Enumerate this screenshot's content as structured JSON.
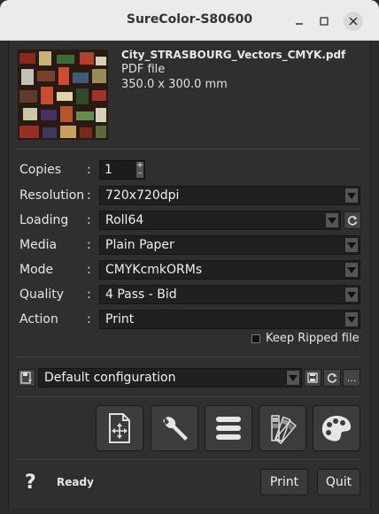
{
  "window": {
    "title": "SureColor-S80600"
  },
  "file": {
    "name": "City_STRASBOURG_Vectors_CMYK.pdf",
    "type": "PDF file",
    "size": "350.0 x 300.0 mm"
  },
  "settings": {
    "copies": {
      "label": "Copies",
      "colon": ":",
      "value": "1"
    },
    "resolution": {
      "label": "Resolution",
      "colon": ":",
      "value": "720x720dpi"
    },
    "loading": {
      "label": "Loading",
      "colon": ":",
      "value": "Roll64"
    },
    "media": {
      "label": "Media",
      "colon": ":",
      "value": "Plain Paper"
    },
    "mode": {
      "label": "Mode",
      "colon": ":",
      "value": "CMYKcmkORMs"
    },
    "quality": {
      "label": "Quality",
      "colon": ":",
      "value": "4 Pass - Bid"
    },
    "action": {
      "label": "Action",
      "colon": ":",
      "value": "Print"
    }
  },
  "keep_ripped": {
    "label": "Keep Ripped file",
    "checked": false
  },
  "configuration": {
    "value": "Default configuration",
    "more": "..."
  },
  "status": {
    "help": "?",
    "text": "Ready"
  },
  "buttons": {
    "print": "Print",
    "quit": "Quit"
  }
}
